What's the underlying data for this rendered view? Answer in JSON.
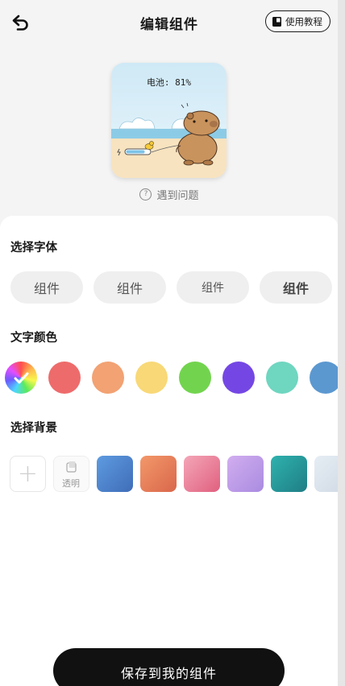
{
  "header": {
    "title": "编辑组件",
    "tutorial_label": "使用教程"
  },
  "preview": {
    "battery_text": "电池: 81%",
    "help_label": "遇到问题"
  },
  "sections": {
    "font": "选择字体",
    "color": "文字颜色",
    "background": "选择背景"
  },
  "fonts": [
    "组件",
    "组件",
    "组件",
    "组件"
  ],
  "colors": [
    "rainbow",
    "#ee6b6b",
    "#f2a273",
    "#f8d877",
    "#72d44e",
    "#7447e4",
    "#6fd6c0",
    "#5b98d0"
  ],
  "backgrounds": {
    "add_label": "+",
    "transparent_label": "透明",
    "gradients": [
      [
        "#5e9be0",
        "#3f6db8"
      ],
      [
        "#f3986a",
        "#d9674b"
      ],
      [
        "#f4a6b8",
        "#e0607f"
      ],
      [
        "#d2aef0",
        "#a98be0"
      ],
      [
        "#2fb2ae",
        "#1f7e86"
      ],
      [
        "#e6edf4",
        "#cfd9e4"
      ]
    ]
  },
  "save_label": "保存到我的组件"
}
